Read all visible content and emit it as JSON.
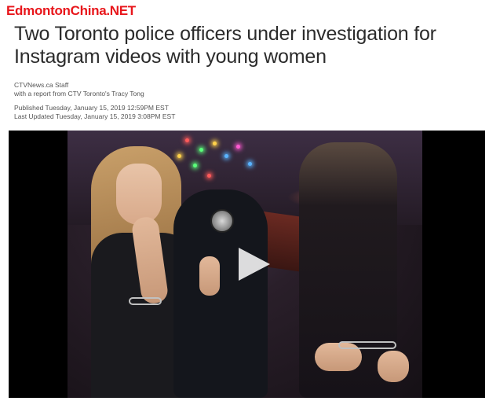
{
  "watermark": "EdmontonChina.NET",
  "article": {
    "headline": "Two Toronto police officers under investigation for Instagram videos with young women",
    "byline": {
      "author": "CTVNews.ca Staff",
      "report": "with a report from CTV Toronto's Tracy Tong"
    },
    "dates": {
      "published": "Published Tuesday, January 15, 2019 12:59PM EST",
      "updated": "Last Updated Tuesday, January 15, 2019 3:08PM EST"
    }
  },
  "video": {
    "play_icon": "play-icon",
    "colors": {
      "play": "#ffffff",
      "letterbox": "#000000"
    }
  }
}
